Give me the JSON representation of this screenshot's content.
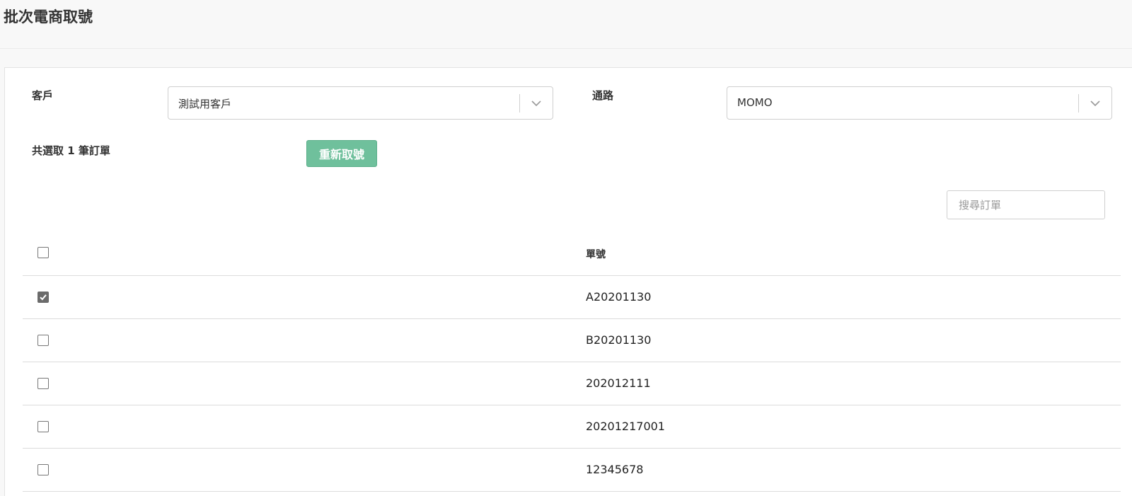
{
  "page": {
    "title": "批次電商取號"
  },
  "form": {
    "customer": {
      "label": "客戶",
      "value": "測試用客戶"
    },
    "channel": {
      "label": "通路",
      "value": "MOMO"
    },
    "selected_count": "共選取 1 筆訂單",
    "refetch_button": "重新取號"
  },
  "search": {
    "placeholder": "搜尋訂單",
    "value": ""
  },
  "table": {
    "header": {
      "order_no": "單號",
      "select_all_checked": false
    },
    "rows": [
      {
        "checked": true,
        "order_no": "A20201130"
      },
      {
        "checked": false,
        "order_no": "B20201130"
      },
      {
        "checked": false,
        "order_no": "202012111"
      },
      {
        "checked": false,
        "order_no": "20201217001"
      },
      {
        "checked": false,
        "order_no": "12345678"
      }
    ]
  },
  "colors": {
    "accent_button": "#6fc09c",
    "checkbox_checked": "#6b6b6b",
    "border": "#cfcfcf",
    "row_divider": "#dcdcdc"
  },
  "icons": {
    "select_chevron": "chevron-down-icon",
    "checkbox_check": "check-icon"
  }
}
